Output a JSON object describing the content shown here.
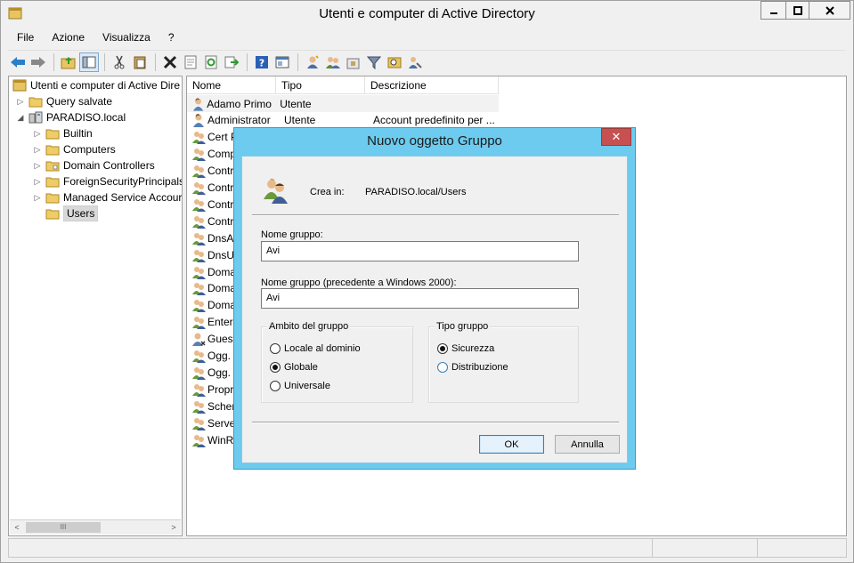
{
  "window": {
    "title": "Utenti e computer di Active Directory"
  },
  "menu": [
    "File",
    "Azione",
    "Visualizza",
    "?"
  ],
  "toolbar": {
    "icons": [
      "back-icon",
      "forward-icon",
      "up-folder-icon",
      "show-tree-icon",
      "cut-icon",
      "paste-icon",
      "delete-icon",
      "properties-icon",
      "refresh-icon",
      "export-icon",
      "help-icon",
      "console-icon",
      "new-user-icon",
      "new-group-icon",
      "new-ou-icon",
      "filter-icon",
      "find-icon",
      "delegate-icon"
    ]
  },
  "tree": {
    "root": "Utenti e computer di Active Dire",
    "items": [
      {
        "label": "Query salvate",
        "level": 1,
        "expander": "▷",
        "icon": "folder-icon"
      },
      {
        "label": "PARADISO.local",
        "level": 1,
        "expander": "◢",
        "icon": "domain-icon"
      },
      {
        "label": "Builtin",
        "level": 2,
        "expander": "▷",
        "icon": "folder-icon"
      },
      {
        "label": "Computers",
        "level": 2,
        "expander": "▷",
        "icon": "folder-icon"
      },
      {
        "label": "Domain Controllers",
        "level": 2,
        "expander": "▷",
        "icon": "folder-icon"
      },
      {
        "label": "ForeignSecurityPrincipals",
        "level": 2,
        "expander": "▷",
        "icon": "folder-icon"
      },
      {
        "label": "Managed Service Accour",
        "level": 2,
        "expander": "▷",
        "icon": "folder-icon"
      },
      {
        "label": "Users",
        "level": 2,
        "expander": "",
        "icon": "folder-icon",
        "selected": true
      }
    ]
  },
  "list": {
    "headers": {
      "name": "Nome",
      "type": "Tipo",
      "description": "Descrizione"
    },
    "rows": [
      {
        "name": "Adamo Primo",
        "type": "Utente",
        "description": "",
        "icon": "user-icon"
      },
      {
        "name": "Administrator",
        "type": "Utente",
        "description": "Account predefinito per ...",
        "icon": "user-icon"
      },
      {
        "name": "Cert P",
        "type": "",
        "description": "",
        "icon": "group-icon"
      },
      {
        "name": "Comp",
        "type": "",
        "description": "",
        "icon": "group-icon"
      },
      {
        "name": "Contro",
        "type": "",
        "description": "",
        "icon": "group-icon"
      },
      {
        "name": "Contro",
        "type": "",
        "description": "",
        "icon": "group-icon"
      },
      {
        "name": "Contro",
        "type": "",
        "description": "",
        "icon": "group-icon"
      },
      {
        "name": "Contro",
        "type": "",
        "description": "",
        "icon": "group-icon"
      },
      {
        "name": "DnsAc",
        "type": "",
        "description": "",
        "icon": "group-icon"
      },
      {
        "name": "DnsUp",
        "type": "",
        "description": "",
        "icon": "group-icon"
      },
      {
        "name": "Doma",
        "type": "",
        "description": "",
        "icon": "group-icon"
      },
      {
        "name": "Doma",
        "type": "",
        "description": "",
        "icon": "group-icon"
      },
      {
        "name": "Doma",
        "type": "",
        "description": "",
        "icon": "group-icon"
      },
      {
        "name": "Enterp",
        "type": "",
        "description": "",
        "icon": "group-icon"
      },
      {
        "name": "Guest",
        "type": "",
        "description": "",
        "icon": "user-disabled-icon"
      },
      {
        "name": "Ogg. a",
        "type": "",
        "description": "",
        "icon": "group-icon"
      },
      {
        "name": "Ogg. r",
        "type": "",
        "description": "",
        "icon": "group-icon"
      },
      {
        "name": "Propri",
        "type": "",
        "description": "",
        "icon": "group-icon"
      },
      {
        "name": "Schem",
        "type": "",
        "description": "",
        "icon": "group-icon"
      },
      {
        "name": "Server",
        "type": "",
        "description": "",
        "icon": "group-icon"
      },
      {
        "name": "WinRM",
        "type": "",
        "description": "",
        "icon": "group-icon"
      }
    ]
  },
  "dialog": {
    "title": "Nuovo oggetto Gruppo",
    "create_in_label": "Crea in:",
    "create_in_value": "PARADISO.local/Users",
    "group_name_label": "Nome gruppo:",
    "group_name_value": "Avi",
    "group_name_pre2000_label": "Nome gruppo (precedente a Windows 2000):",
    "group_name_pre2000_value": "Avi",
    "scope": {
      "legend": "Ambito del gruppo",
      "options": [
        {
          "label": "Locale al dominio",
          "checked": false
        },
        {
          "label": "Globale",
          "checked": true
        },
        {
          "label": "Universale",
          "checked": false
        }
      ]
    },
    "type": {
      "legend": "Tipo gruppo",
      "options": [
        {
          "label": "Sicurezza",
          "checked": true
        },
        {
          "label": "Distribuzione",
          "checked": false
        }
      ]
    },
    "ok_label": "OK",
    "cancel_label": "Annulla",
    "close_glyph": "✕"
  },
  "colors": {
    "dialog_frame": "#6ccbee",
    "close_button": "#c75050",
    "accent_blue": "#3c7fb1"
  }
}
